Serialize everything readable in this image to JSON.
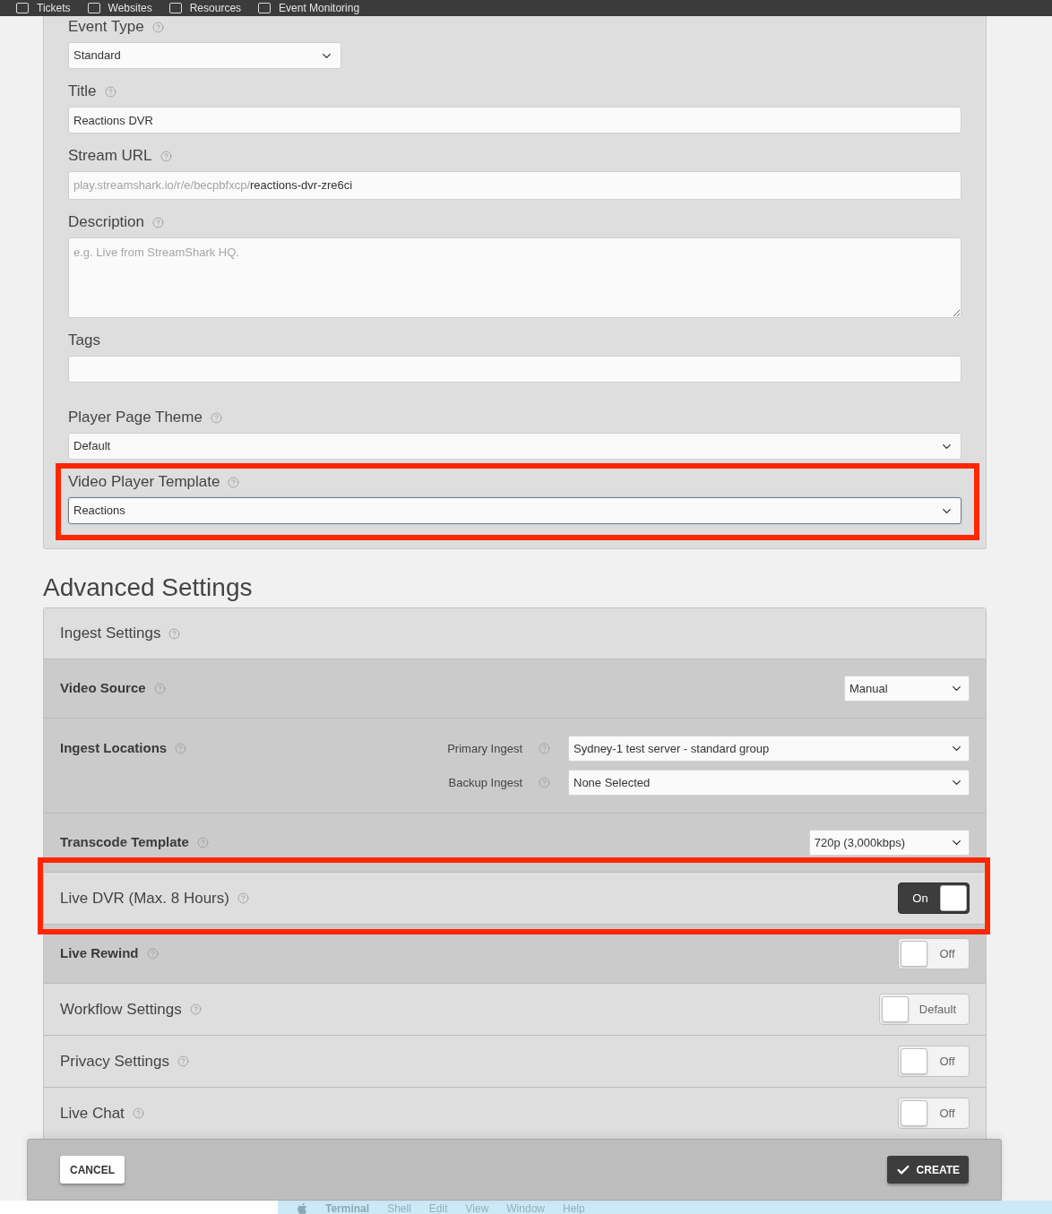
{
  "top_nav": {
    "items": [
      {
        "label": "Tickets"
      },
      {
        "label": "Websites"
      },
      {
        "label": "Resources"
      },
      {
        "label": "Event Monitoring"
      }
    ]
  },
  "event_form": {
    "fields": [
      {
        "kind": "select",
        "label": "Event Type",
        "help": true,
        "compact": true,
        "focused": false,
        "highlighted": false,
        "value": "Standard"
      },
      {
        "kind": "text",
        "label": "Title",
        "help": true,
        "compact": false,
        "focused": false,
        "highlighted": false,
        "value": "Reactions DVR"
      },
      {
        "kind": "url",
        "label": "Stream URL",
        "help": true,
        "compact": false,
        "focused": false,
        "highlighted": false,
        "prefix": "play.streamshark.io/r/e/becpbfxcp/",
        "value": "reactions-dvr-zre6ci"
      },
      {
        "kind": "textarea",
        "label": "Description",
        "help": true,
        "compact": false,
        "focused": false,
        "highlighted": false,
        "placeholder": "e.g. Live from StreamShark HQ."
      },
      {
        "kind": "tags",
        "label": "Tags",
        "help": false,
        "compact": false,
        "focused": false,
        "highlighted": false
      },
      {
        "kind": "select",
        "label": "Player Page Theme",
        "help": true,
        "compact": false,
        "focused": false,
        "highlighted": false,
        "value": "Default"
      },
      {
        "kind": "select",
        "label": "Video Player Template",
        "help": true,
        "compact": false,
        "focused": true,
        "highlighted": true,
        "value": "Reactions"
      }
    ]
  },
  "advanced_settings": {
    "title": "Advanced Settings",
    "rows": [
      {
        "kind": "group",
        "label": "Ingest Settings",
        "help": true,
        "highlighted": false
      },
      {
        "kind": "option",
        "label": "Video Source",
        "help": true,
        "highlighted": false,
        "control": {
          "kind": "select",
          "value": "Manual"
        }
      },
      {
        "kind": "option",
        "label": "Ingest Locations",
        "help": true,
        "highlighted": false,
        "control": {
          "kind": "ingest",
          "selects": [
            {
              "label": "Primary Ingest",
              "help": true,
              "value": "Sydney-1 test server - standard group"
            },
            {
              "label": "Backup Ingest",
              "help": true,
              "value": "None Selected"
            }
          ]
        }
      },
      {
        "kind": "option",
        "label": "Transcode Template",
        "help": true,
        "highlighted": false,
        "control": {
          "kind": "select",
          "value": "720p (3,000kbps)"
        }
      },
      {
        "kind": "group",
        "label": "Live DVR (Max. 8 Hours)",
        "help": true,
        "highlighted": true,
        "control": {
          "kind": "toggle",
          "on": true,
          "text": "On"
        }
      },
      {
        "kind": "option",
        "label": "Live Rewind",
        "help": true,
        "highlighted": false,
        "control": {
          "kind": "toggle",
          "on": false,
          "text": "Off"
        }
      },
      {
        "kind": "group",
        "label": "Workflow Settings",
        "help": true,
        "highlighted": false,
        "control": {
          "kind": "toggle",
          "on": false,
          "text": "Default"
        }
      },
      {
        "kind": "group",
        "label": "Privacy Settings",
        "help": true,
        "highlighted": false,
        "control": {
          "kind": "toggle",
          "on": false,
          "text": "Off"
        }
      },
      {
        "kind": "group",
        "label": "Live Chat",
        "help": true,
        "highlighted": false,
        "control": {
          "kind": "toggle",
          "on": false,
          "text": "Off"
        }
      }
    ]
  },
  "footer": {
    "buttons": [
      {
        "kind": "secondary",
        "label": "CANCEL"
      },
      {
        "kind": "primary",
        "label": "CREATE"
      }
    ]
  },
  "mac_menu_bar": {
    "items": [
      {
        "kind": "app",
        "label": "Terminal"
      },
      {
        "kind": "menu",
        "label": "Shell"
      },
      {
        "kind": "menu",
        "label": "Edit"
      },
      {
        "kind": "menu",
        "label": "View"
      },
      {
        "kind": "menu",
        "label": "Window"
      },
      {
        "kind": "menu",
        "label": "Help"
      }
    ]
  }
}
